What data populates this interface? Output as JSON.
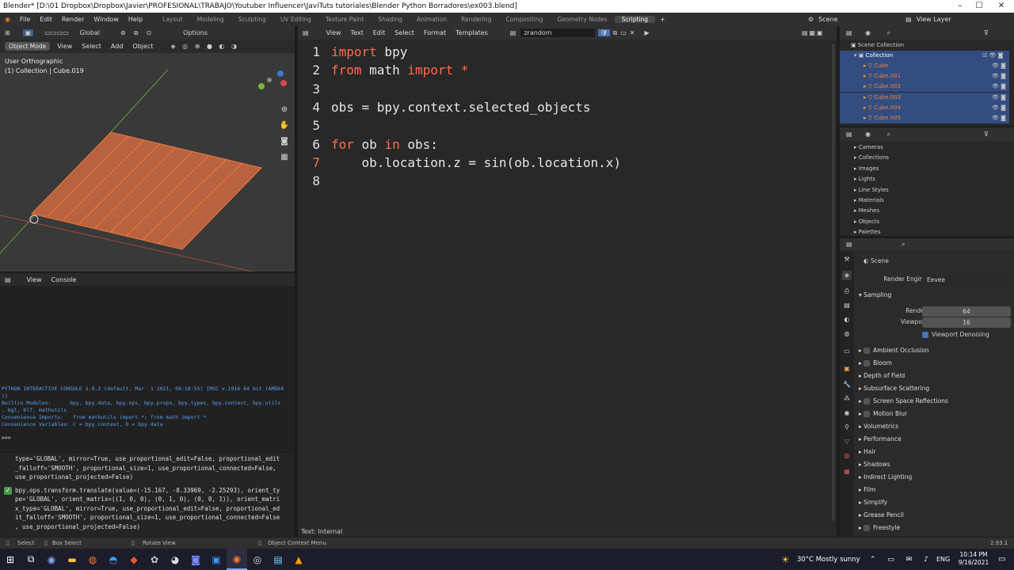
{
  "window": {
    "title": "Blender* [D:\\01 Dropbox\\Dropbox\\Javier\\PROFESIONAL\\TRABAJO\\Youtuber Influencer\\JaviTuts tutoriales\\Blender Python Borradores\\ex003.blend]"
  },
  "menu": [
    "File",
    "Edit",
    "Render",
    "Window",
    "Help"
  ],
  "workspaces": [
    "Layout",
    "Modeling",
    "Sculpting",
    "UV Editing",
    "Texture Paint",
    "Shading",
    "Animation",
    "Rendering",
    "Compositing",
    "Geometry Nodes",
    "Scripting"
  ],
  "active_workspace": "Scripting",
  "scene_name": "Scene",
  "view_layer": "View Layer",
  "viewport": {
    "orientation": "Global",
    "options": "Options",
    "mode": "Object Mode",
    "menus": [
      "View",
      "Select",
      "Add",
      "Object"
    ],
    "view_name": "User Orthographic",
    "collection_label": "(1) Collection | Cube.019"
  },
  "console": {
    "menus": [
      "View",
      "Console"
    ],
    "lines": [
      "PYTHON INTERACTIVE CONSOLE 3.9.2 (default, Mar  1 2021, 08:18:55) [MSC v.1916 64 bit (AMD64",
      ")]",
      "",
      "Builtin Modules:      bpy, bpy.data, bpy.ops, bpy.props, bpy.types, bpy.context, bpy.utils",
      ", bgl, blf, mathutils",
      "Convenience Imports:   from mathutils import *; from math import *",
      "Convenience Variables: C = bpy.context, D = bpy.data"
    ],
    "prompt": ">>> "
  },
  "info_log": {
    "lines": [
      "type='GLOBAL', mirror=True, use_proportional_edit=False, proportional_edit",
      "_falloff='SMOOTH', proportional_size=1, use_proportional_connected=False,",
      "use_proportional_projected=False)",
      "",
      "bpy.ops.transform.translate(value=(-15.167, -8.33969, -2.25293), orient_ty",
      "pe='GLOBAL', orient_matrix=((1, 0, 0), (0, 1, 0), (0, 0, 1)), orient_matri",
      "x_type='GLOBAL', mirror=True, use_proportional_edit=False, proportional_ed",
      "it_falloff='SMOOTH', proportional_size=1, use_proportional_connected=False",
      ", use_proportional_projected=False)"
    ]
  },
  "text_editor": {
    "menus": [
      "View",
      "Text",
      "Edit",
      "Select",
      "Format",
      "Templates"
    ],
    "filename": "zrandom",
    "footer": "Text: Internal",
    "lines": [
      {
        "n": "1",
        "parts": [
          {
            "t": "import",
            "k": true
          },
          {
            "t": " bpy",
            "k": false
          }
        ]
      },
      {
        "n": "2",
        "parts": [
          {
            "t": "from",
            "k": true
          },
          {
            "t": " math ",
            "k": false
          },
          {
            "t": "import *",
            "k": true
          }
        ]
      },
      {
        "n": "3",
        "parts": []
      },
      {
        "n": "4",
        "parts": [
          {
            "t": "obs = bpy.context.selected_objects",
            "k": false
          }
        ]
      },
      {
        "n": "5",
        "parts": []
      },
      {
        "n": "6",
        "parts": [
          {
            "t": "for",
            "k": true
          },
          {
            "t": " ob ",
            "k": false
          },
          {
            "t": "in",
            "k": true
          },
          {
            "t": " obs:",
            "k": false
          }
        ]
      },
      {
        "n": "7",
        "parts": [
          {
            "t": "    ob.location.z = sin(ob.location.x)",
            "k": false
          }
        ]
      },
      {
        "n": "8",
        "parts": []
      }
    ]
  },
  "outliner": {
    "root": "Scene Collection",
    "collection": "Collection",
    "items": [
      "Cube",
      "Cube.001",
      "Cube.002",
      "Cube.003",
      "Cube.004",
      "Cube.005"
    ]
  },
  "data_api": {
    "items": [
      "Cameras",
      "Collections",
      "Images",
      "Lights",
      "Line Styles",
      "Materials",
      "Meshes",
      "Objects",
      "Palettes"
    ]
  },
  "properties": {
    "scene": "Scene",
    "render_engine_label": "Render Engine",
    "render_engine": "Eevee",
    "sampling": "Sampling",
    "render_label": "Render",
    "render_value": "64",
    "viewport_label": "Viewport",
    "viewport_value": "16",
    "denoise": "Viewport Denoising",
    "panels": [
      "Ambient Occlusion",
      "Bloom",
      "Depth of Field",
      "Subsurface Scattering",
      "Screen Space Reflections",
      "Motion Blur",
      "Volumetrics",
      "Performance",
      "Hair",
      "Shadows",
      "Indirect Lighting",
      "Film",
      "Simplify",
      "Grease Pencil",
      "Freestyle"
    ],
    "panels_with_checkbox": [
      true,
      true,
      false,
      false,
      true,
      true,
      false,
      false,
      false,
      false,
      false,
      false,
      false,
      false,
      true
    ]
  },
  "statusbar": {
    "select": "Select",
    "box_select": "Box Select",
    "rotate_view": "Rotate View",
    "context_menu": "Object Context Menu",
    "version": "2.93.1"
  },
  "taskbar": {
    "weather": "30°C  Mostly sunny",
    "lang": "ENG",
    "time": "10:14 PM",
    "date": "9/16/2021"
  }
}
